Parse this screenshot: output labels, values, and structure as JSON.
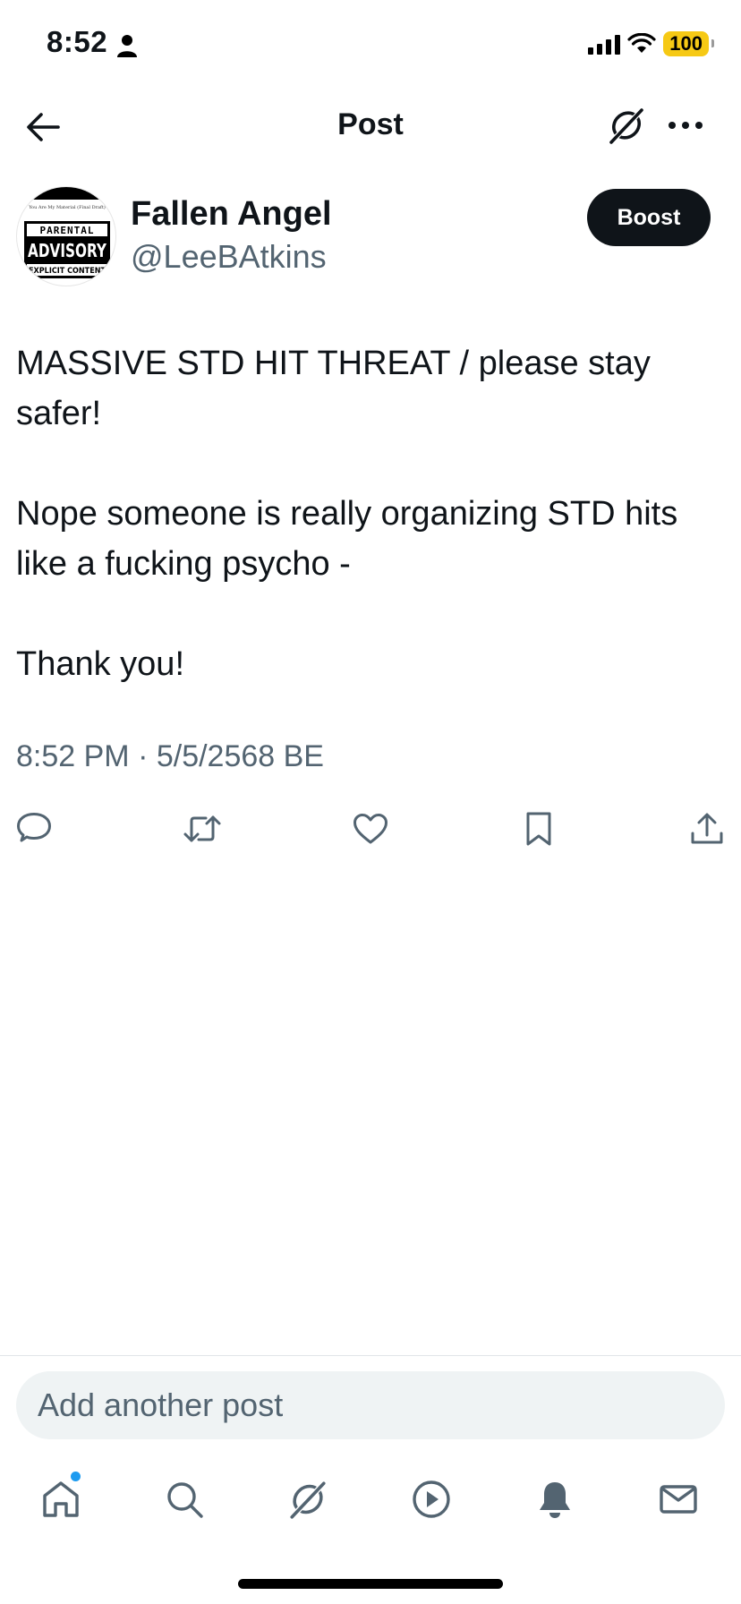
{
  "status_bar": {
    "time": "8:52",
    "battery": "100",
    "battery_color": "#f6c915"
  },
  "header": {
    "title": "Post",
    "back_icon": "arrow-left-icon",
    "grok_icon": "grok-icon",
    "more_icon": "more-horizontal-icon"
  },
  "author": {
    "name": "Fallen Angel",
    "handle": "@LeeBAtkins",
    "boost_label": "Boost",
    "avatar": {
      "top_caption": "You Are My Material (Final Draft)",
      "line1": "PARENTAL",
      "line2": "ADVISORY",
      "line3": "EXPLICIT CONTENT"
    }
  },
  "post": {
    "paragraphs": [
      "MASSIVE STD HIT THREAT / please stay safer!",
      "Nope someone is really organizing STD hits like a fucking psycho -",
      "Thank you!"
    ],
    "timestamp": "8:52 PM · 5/5/2568 BE"
  },
  "actions": [
    {
      "name": "reply",
      "icon": "reply-icon"
    },
    {
      "name": "repost",
      "icon": "repost-icon"
    },
    {
      "name": "like",
      "icon": "heart-icon"
    },
    {
      "name": "bookmark",
      "icon": "bookmark-icon"
    },
    {
      "name": "share",
      "icon": "share-icon"
    }
  ],
  "reply": {
    "placeholder": "Add another post"
  },
  "tabs": [
    {
      "name": "home",
      "icon": "home-icon",
      "has_notification_dot": true
    },
    {
      "name": "search",
      "icon": "search-icon"
    },
    {
      "name": "grok",
      "icon": "grok-icon"
    },
    {
      "name": "video",
      "icon": "play-icon"
    },
    {
      "name": "notifications",
      "icon": "bell-icon"
    },
    {
      "name": "messages",
      "icon": "mail-icon"
    }
  ],
  "colors": {
    "text_primary": "#0f1419",
    "text_secondary": "#536471",
    "accent": "#1d9bf0",
    "input_bg": "#eff3f4"
  }
}
